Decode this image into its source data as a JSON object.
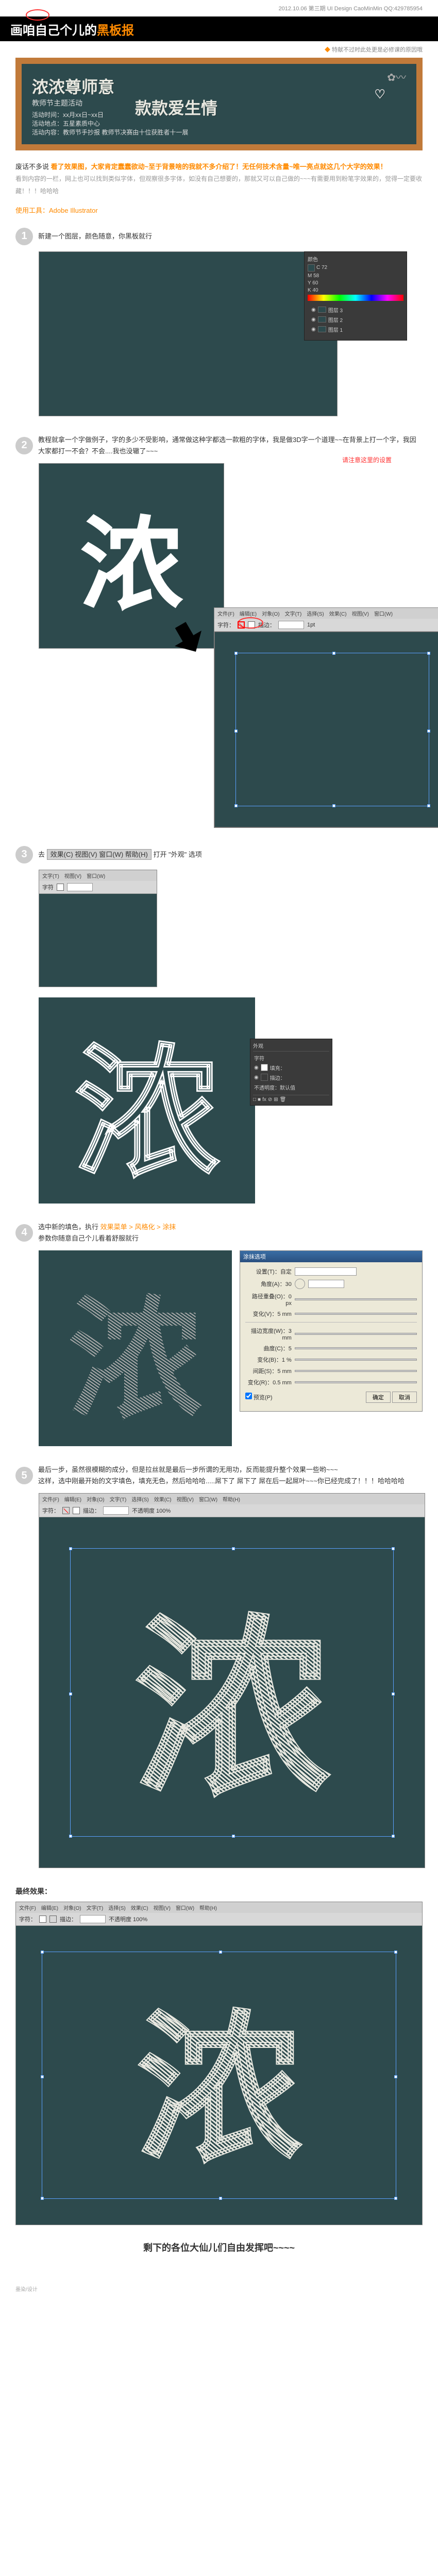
{
  "meta": {
    "date": "2012.10.06  第三期  UI Design CaoMinMin  QQ:429785954",
    "tagline": "特献不过时此处更是必修课的原因哦"
  },
  "header": {
    "title_white": "画咱自己个儿的",
    "title_orange": " 黑板报"
  },
  "blackboard": {
    "line1": "浓浓尊师意",
    "line2": "款款爱生情",
    "sub_title": "教师节主题活动",
    "sub_meta1": "活动时间：xx月xx日~xx日",
    "sub_meta2": "活动地点：五星素质中心",
    "sub_meta3": "活动内容：教师节手抄报  教师节决赛由十位获胜者十一展"
  },
  "intro": {
    "p1a": "废话不多说 ",
    "p1b": "看了效果图，大家肯定蠢蠢欲动~至于背景啥的我就不多介绍了！无任何技术含量~唯一亮点就这几个大字的效果！",
    "p2": "看到内容的一栏，网上也可以找到类似字体，但观察很多字体，如没有自己想要的，那就又可以自己做的~~~有需要用到粉笔字效果的，觉得一定要收藏！！！哈哈哈"
  },
  "tool": {
    "label": "使用工具：Adobe Illustrator"
  },
  "steps": {
    "s1": {
      "num": "1",
      "text": "新建一个图层，颜色随意，你黑板就行"
    },
    "s2": {
      "num": "2",
      "text_a": "教程就拿一个字做例子，字的多少不受影响，通常做这种字都选一款粗的字体，我是做3D字一个道理~~在背景上打一个字，我因大家都打一不会？不会....我也没辙了~~~",
      "callout": "请注意这里的设置",
      "big_char": "浓"
    },
    "s3": {
      "num": "3",
      "text_a": "去 ",
      "text_b": " 打开 \"外观\" 选项",
      "menu_items": "效果(C)  视图(V)  窗口(W)  帮助(H)",
      "big_char": "浓",
      "panel_items": [
        "外观",
        "字符",
        "填充：",
        "描边：",
        "不透明度：默认值"
      ]
    },
    "s4": {
      "num": "4",
      "text_a": "选中新的填色，执行 ",
      "text_b": "效果菜单 > 风格化 > 涂抹",
      "text_c": "参数你随意自己个儿看着舒服就行",
      "dialog_title": "涂抹选项",
      "dlg": {
        "preset": "设置(T)：自定",
        "angle": "角度(A)：30",
        "path_overlap": "路径重叠(O)：0 px",
        "variation1": "变化(V)：5 mm",
        "stroke_width": "描边宽度(W)：3 mm",
        "curviness": "曲度(C)：5",
        "variation2": "变化(B)：1 %",
        "spacing": "间距(S)：5 mm",
        "variation3": "变化(R)：0.5 mm",
        "preview": "预览(P)",
        "ok": "确定",
        "cancel": "取消"
      }
    },
    "s5": {
      "num": "5",
      "text": "最后一步，虽然很模糊的成分，但是拉丝就是最后一步所谓的无用功，反而能提升整个效果一些哟~~~\n这样，选中刚最开始的文字填色，填充无色，然后哈哈哈.....屌下了 屌下了 屌在后一起屌叶~~~你已经完成了！！！哈哈哈哈"
    }
  },
  "final": {
    "label": "最终效果：",
    "outro": "剩下的各位大仙儿们自由发挥吧~~~~"
  },
  "footer": {
    "text": "墨染/设计"
  },
  "ui": {
    "menubar": [
      "文件(F)",
      "编辑(E)",
      "对象(O)",
      "文字(T)",
      "选择(S)",
      "效果(C)",
      "视图(V)",
      "窗口(W)",
      "帮助(H)"
    ],
    "layers": [
      "图层 3",
      "图层 2",
      "图层 1"
    ]
  }
}
